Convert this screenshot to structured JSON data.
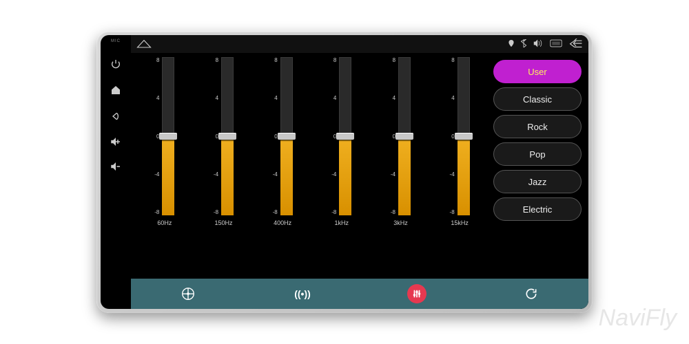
{
  "watermark": "NaviFly",
  "hw": {
    "mic": "MIC"
  },
  "scale": {
    "top": "8",
    "q3": "4",
    "mid": "0",
    "q1": "-4",
    "bot": "-8"
  },
  "eq": {
    "bands": [
      {
        "freq": "60Hz",
        "value": 0
      },
      {
        "freq": "150Hz",
        "value": 0
      },
      {
        "freq": "400Hz",
        "value": 0
      },
      {
        "freq": "1kHz",
        "value": 0
      },
      {
        "freq": "3kHz",
        "value": 0
      },
      {
        "freq": "15kHz",
        "value": 0
      }
    ]
  },
  "presets": {
    "active": 0,
    "items": [
      "User",
      "Classic",
      "Rock",
      "Pop",
      "Jazz",
      "Electric"
    ]
  },
  "bottom": {
    "balance_icon": "balance-icon",
    "surround_icon": "surround-icon",
    "eq_icon": "eq-icon",
    "refresh_icon": "refresh-icon"
  }
}
